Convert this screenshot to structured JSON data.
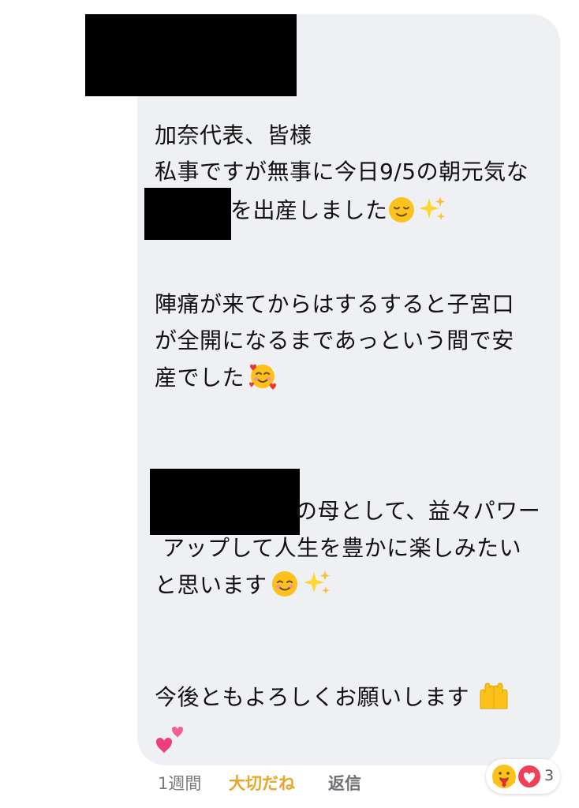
{
  "message": {
    "lines": [
      "加奈代表、皆様",
      "私事ですが無事に今日9/5の朝元気な",
      "を出産しました",
      "陣痛が来てからはするすると子宮口",
      "が全開になるまであっという間で安",
      "産でした",
      "の母として、益々パワー",
      "アップして人生を豊かに楽しみたい",
      "と思います",
      "今後ともよろしくお願いします"
    ]
  },
  "emojis": {
    "relieved": "relieved-face-icon",
    "sparkles": "sparkles-icon",
    "smiling_hearts": "smiling-face-with-hearts-icon",
    "smiling": "smiling-face-icon",
    "palms_up": "palms-up-together-icon",
    "two_hearts": "two-hearts-icon"
  },
  "footer": {
    "timestamp": "1週間",
    "like_label": "大切だね",
    "reply_label": "返信"
  },
  "reactions": {
    "count": "3",
    "types": [
      "care",
      "love"
    ]
  },
  "colors": {
    "bubble": "#eff0f4",
    "like_active": "#e8a72a",
    "love_red": "#f33e58"
  }
}
